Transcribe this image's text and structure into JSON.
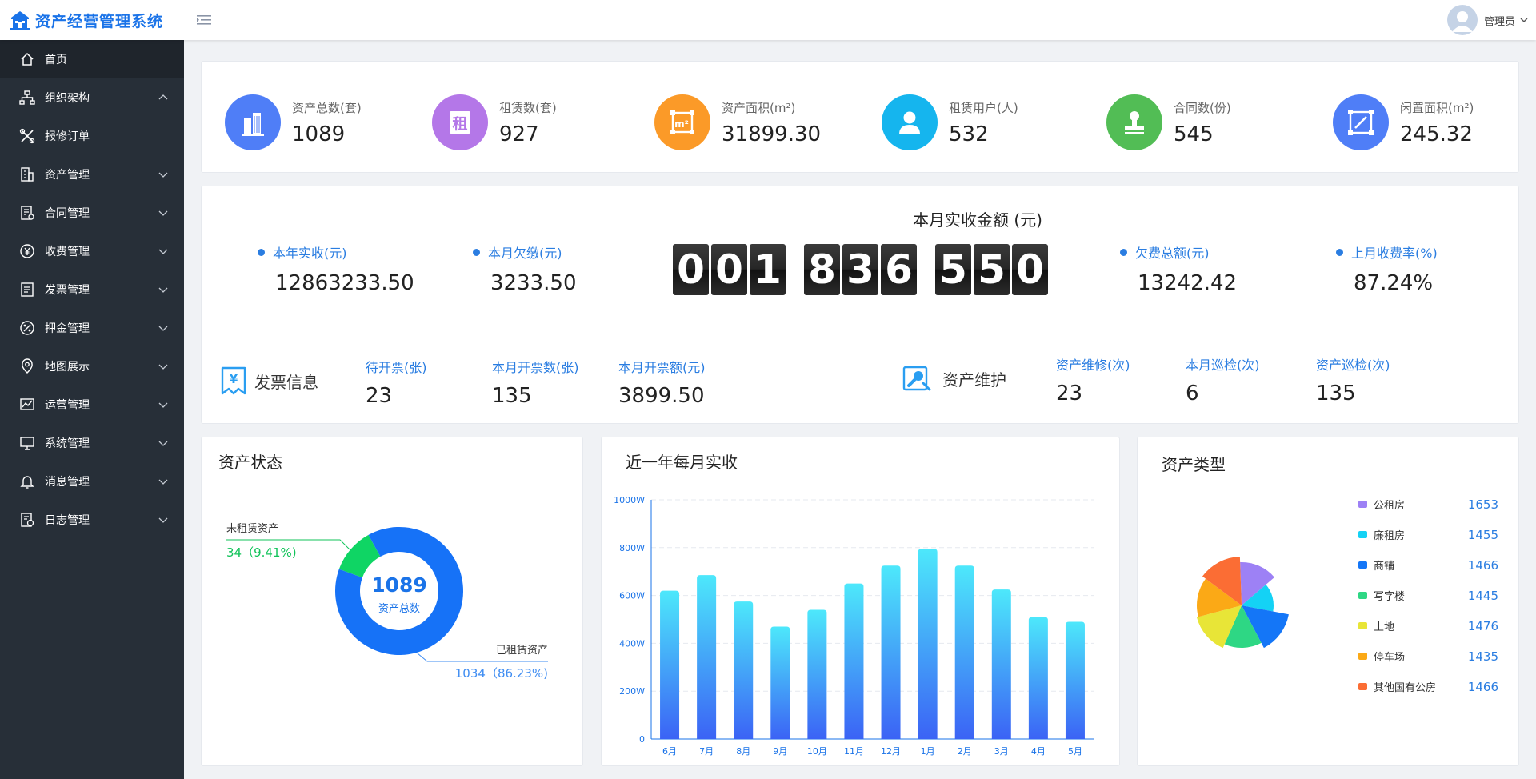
{
  "app": {
    "title": "资产经营管理系统",
    "user": "管理员"
  },
  "sidebar": {
    "items": [
      {
        "label": "首页",
        "icon": "home-icon",
        "expandable": false,
        "expanded": false
      },
      {
        "label": "组织架构",
        "icon": "org-chart-icon",
        "expandable": true,
        "expanded": true
      },
      {
        "label": "报修订单",
        "icon": "tools-icon",
        "expandable": false,
        "expanded": false
      },
      {
        "label": "资产管理",
        "icon": "building-icon",
        "expandable": true,
        "expanded": false
      },
      {
        "label": "合同管理",
        "icon": "contract-icon",
        "expandable": true,
        "expanded": false
      },
      {
        "label": "收费管理",
        "icon": "yuan-icon",
        "expandable": true,
        "expanded": false
      },
      {
        "label": "发票管理",
        "icon": "invoice-icon",
        "expandable": true,
        "expanded": false
      },
      {
        "label": "押金管理",
        "icon": "percent-icon",
        "expandable": true,
        "expanded": false
      },
      {
        "label": "地图展示",
        "icon": "map-pin-icon",
        "expandable": true,
        "expanded": false
      },
      {
        "label": "运营管理",
        "icon": "line-chart-icon",
        "expandable": true,
        "expanded": false
      },
      {
        "label": "系统管理",
        "icon": "monitor-icon",
        "expandable": true,
        "expanded": false
      },
      {
        "label": "消息管理",
        "icon": "bell-icon",
        "expandable": true,
        "expanded": false
      },
      {
        "label": "日志管理",
        "icon": "log-icon",
        "expandable": true,
        "expanded": false
      }
    ]
  },
  "stats": [
    {
      "label": "资产总数(套)",
      "value": "1089",
      "icon": "buildings-icon",
      "color": "#4f7ef7"
    },
    {
      "label": "租赁数(套)",
      "value": "927",
      "icon": "rent-icon",
      "color": "#b477e8"
    },
    {
      "label": "资产面积(m²)",
      "value": "31899.30",
      "icon": "area-icon",
      "color": "#fb9a28"
    },
    {
      "label": "租赁用户(人)",
      "value": "532",
      "icon": "user-icon",
      "color": "#15b5ee"
    },
    {
      "label": "合同数(份)",
      "value": "545",
      "icon": "stamp-icon",
      "color": "#52bd55"
    },
    {
      "label": "闲置面积(m²)",
      "value": "245.32",
      "icon": "resize-icon",
      "color": "#4f7ef7"
    }
  ],
  "finance": {
    "title": "本月实收金额 (元)",
    "counter_groups": [
      "001",
      "836",
      "550"
    ],
    "left": [
      {
        "label": "本年实收(元)",
        "value": "12863233.50"
      },
      {
        "label": "本月欠缴(元)",
        "value": "3233.50"
      }
    ],
    "right": [
      {
        "label": "欠费总额(元)",
        "value": "13242.42"
      },
      {
        "label": "上月收费率(%)",
        "value": "87.24%"
      }
    ]
  },
  "invoice": {
    "title": "发票信息",
    "items": [
      {
        "label": "待开票(张)",
        "value": "23"
      },
      {
        "label": "本月开票数(张)",
        "value": "135"
      },
      {
        "label": "本月开票额(元)",
        "value": "3899.50"
      }
    ]
  },
  "maintenance": {
    "title": "资产维护",
    "items": [
      {
        "label": "资产维修(次)",
        "value": "23"
      },
      {
        "label": "本月巡检(次)",
        "value": "6"
      },
      {
        "label": "资产巡检(次)",
        "value": "135"
      }
    ]
  },
  "asset_status": {
    "title": "资产状态",
    "center_value": "1089",
    "center_label": "资产总数",
    "unrented_label": "未租赁资产",
    "unrented_text": "34（9.41%)",
    "rented_label": "已租赁资产",
    "rented_text": "1034（86.23%)"
  },
  "monthly_title": "近一年每月实收",
  "asset_type_title": "资产类型",
  "colors": {
    "primary": "#1a73e8",
    "sidebar_bg": "#272f38",
    "bar_top": "#4de8fb",
    "bar_bottom": "#3b63f5"
  },
  "chart_data": [
    {
      "type": "pie",
      "subtype": "donut",
      "labels": [
        "已租赁资产",
        "未租赁资产"
      ],
      "values": [
        1034,
        34
      ],
      "display_text": [
        "1034（86.23%)",
        "34（9.41%)"
      ],
      "colors": [
        "#1672f7",
        "#0fd564"
      ],
      "center_text": "1089",
      "center_label": "资产总数"
    },
    {
      "type": "bar",
      "title": "近一年每月实收",
      "categories": [
        "6月",
        "7月",
        "8月",
        "9月",
        "10月",
        "11月",
        "12月",
        "1月",
        "2月",
        "3月",
        "4月",
        "5月"
      ],
      "values": [
        620,
        685,
        575,
        470,
        540,
        650,
        725,
        795,
        725,
        625,
        510,
        490
      ],
      "y_ticks": [
        "0",
        "200W",
        "400W",
        "600W",
        "800W",
        "1000W"
      ],
      "ylim": [
        0,
        1000
      ],
      "grid": true
    },
    {
      "type": "pie",
      "subtype": "rose",
      "title": "资产类型",
      "labels": [
        "公租房",
        "廉租房",
        "商铺",
        "写字楼",
        "土地",
        "停车场",
        "其他国有公房"
      ],
      "values": [
        1653,
        1455,
        1466,
        1445,
        1476,
        1435,
        1466
      ],
      "colors": [
        "#9d81f5",
        "#14d2f5",
        "#1476f7",
        "#2ed784",
        "#e8e537",
        "#fba916",
        "#fb6d34"
      ],
      "legend_position": "right"
    }
  ]
}
